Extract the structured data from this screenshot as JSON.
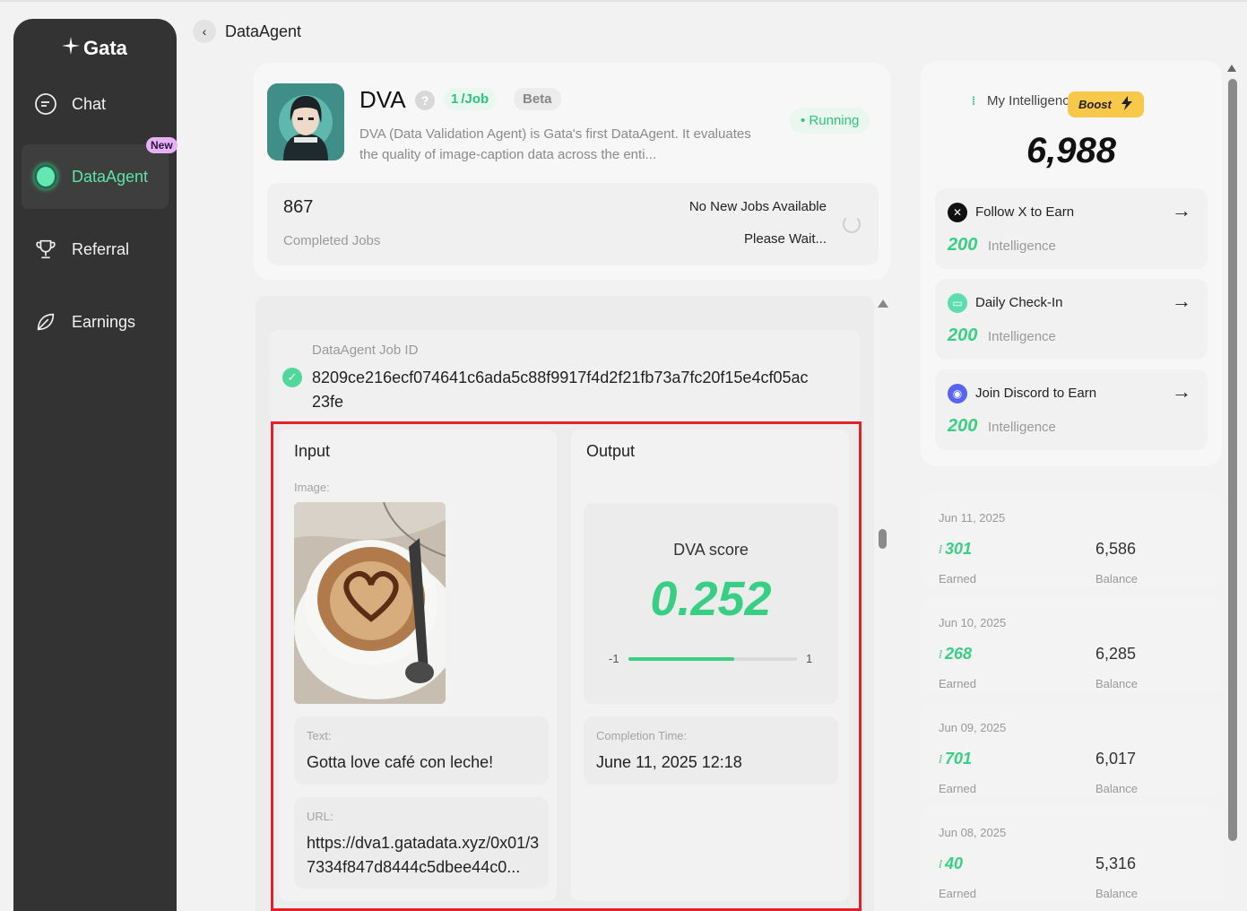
{
  "sidebar": {
    "brand": "Gata",
    "items": [
      {
        "label": "Chat",
        "icon": "chat-icon"
      },
      {
        "label": "DataAgent",
        "icon": "agent-dot-icon",
        "active": true,
        "badge": "New"
      },
      {
        "label": "Referral",
        "icon": "trophy-icon"
      },
      {
        "label": "Earnings",
        "icon": "leaf-icon"
      }
    ]
  },
  "header": {
    "back_glyph": "‹",
    "title": "DataAgent"
  },
  "agent": {
    "name": "DVA",
    "help_glyph": "?",
    "rate": "1 /Job",
    "rate_coin": "1",
    "beta": "Beta",
    "status": "Running",
    "description": "DVA (Data Validation Agent) is Gata's first DataAgent. It evaluates the quality of image-caption data across the enti...",
    "completed_count": "867",
    "completed_label": "Completed Jobs",
    "jobs_status": "No New Jobs Available",
    "wait_text": "Please Wait..."
  },
  "job": {
    "id_label": "DataAgent Job ID",
    "id_value": "8209ce216ecf074641c6ada5c88f9917f4d2f21fb73a7fc20f15e4cf05ac23fe",
    "input": {
      "title": "Input",
      "image_label": "Image:",
      "text_label": "Text:",
      "text_value": "Gotta love café con leche!",
      "url_label": "URL:",
      "url_value": "https://dva1.gatadata.xyz/0x01/37334f847d8444c5dbee44c0..."
    },
    "output": {
      "title": "Output",
      "score_label": "DVA score",
      "score_value": "0.252",
      "scale_min": "-1",
      "scale_max": "1",
      "score_fraction": 0.626,
      "completion_label": "Completion Time:",
      "completion_value": "June 11, 2025 12:18"
    }
  },
  "intelligence": {
    "label": "My Intelligence",
    "boost_label": "Boost",
    "value": "6,988",
    "tasks": [
      {
        "title": "Follow X to Earn",
        "amount": "200",
        "unit": "Intelligence",
        "icon": "x-logo-icon"
      },
      {
        "title": "Daily Check-In",
        "amount": "200",
        "unit": "Intelligence",
        "icon": "calendar-icon"
      },
      {
        "title": "Join Discord to Earn",
        "amount": "200",
        "unit": "Intelligence",
        "icon": "discord-icon"
      }
    ]
  },
  "history": [
    {
      "date": "Jun 11, 2025",
      "earned": "301",
      "earned_label": "Earned",
      "balance": "6,586",
      "balance_label": "Balance"
    },
    {
      "date": "Jun 10, 2025",
      "earned": "268",
      "earned_label": "Earned",
      "balance": "6,285",
      "balance_label": "Balance"
    },
    {
      "date": "Jun 09, 2025",
      "earned": "701",
      "earned_label": "Earned",
      "balance": "6,017",
      "balance_label": "Balance"
    },
    {
      "date": "Jun 08, 2025",
      "earned": "40",
      "earned_label": "Earned",
      "balance": "5,316",
      "balance_label": "Balance"
    }
  ],
  "colors": {
    "accent": "#38cf84",
    "sidebar_bg": "#333333",
    "highlight": "#e0202a",
    "boost": "#f7c84a"
  }
}
